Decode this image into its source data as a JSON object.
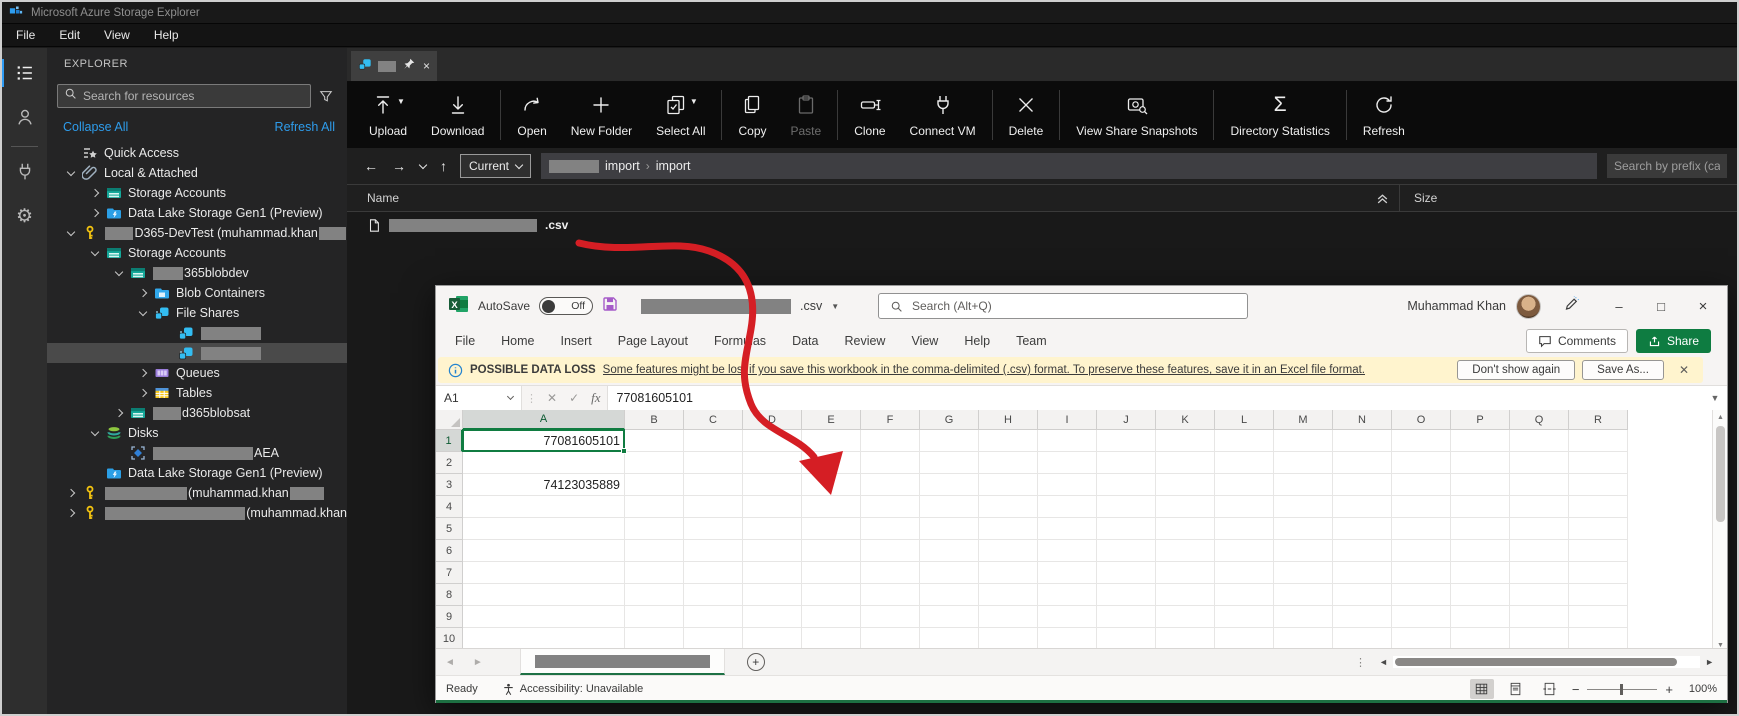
{
  "titleBar": {
    "title": "Microsoft Azure Storage Explorer"
  },
  "menuBar": {
    "items": [
      "File",
      "Edit",
      "View",
      "Help"
    ]
  },
  "activityBar": {
    "items": [
      {
        "icon": "explorer",
        "active": true
      },
      {
        "icon": "account",
        "active": false
      },
      {
        "icon": "plug",
        "active": false
      },
      {
        "icon": "settings",
        "active": false
      }
    ]
  },
  "explorer": {
    "header": "EXPLORER",
    "search": {
      "placeholder": "Search for resources"
    },
    "collapseAll": "Collapse All",
    "refreshAll": "Refresh All",
    "tree": [
      {
        "level": 0,
        "chevron": null,
        "icon": "quickaccess",
        "parts": [
          {
            "text": "Quick Access"
          }
        ]
      },
      {
        "level": 0,
        "chevron": "down",
        "icon": "attach",
        "parts": [
          {
            "text": "Local & Attached"
          }
        ]
      },
      {
        "level": 1,
        "chevron": "right",
        "icon": "storage",
        "parts": [
          {
            "text": "Storage Accounts"
          }
        ]
      },
      {
        "level": 1,
        "chevron": "right",
        "icon": "datalake",
        "parts": [
          {
            "text": "Data Lake Storage Gen1 (Preview)"
          }
        ]
      },
      {
        "level": 0,
        "chevron": "down",
        "icon": "key",
        "parts": [
          {
            "redact": 44
          },
          {
            "text": "D365-DevTest (muhammad.khan"
          },
          {
            "redact": 42
          }
        ]
      },
      {
        "level": 1,
        "chevron": "down",
        "icon": "storage",
        "parts": [
          {
            "text": "Storage Accounts"
          }
        ]
      },
      {
        "level": 2,
        "chevron": "down",
        "icon": "storage",
        "parts": [
          {
            "redact": 30
          },
          {
            "text": "365blobdev"
          }
        ]
      },
      {
        "level": 3,
        "chevron": "right",
        "icon": "blob",
        "parts": [
          {
            "text": "Blob Containers"
          }
        ]
      },
      {
        "level": 3,
        "chevron": "down",
        "icon": "fileshare",
        "parts": [
          {
            "text": "File Shares"
          }
        ]
      },
      {
        "level": 4,
        "chevron": null,
        "icon": "fileshare",
        "parts": [
          {
            "redact": 60
          }
        ]
      },
      {
        "level": 4,
        "chevron": null,
        "icon": "fileshare",
        "parts": [
          {
            "redact": 60
          }
        ],
        "selected": true
      },
      {
        "level": 3,
        "chevron": "right",
        "icon": "queue",
        "parts": [
          {
            "text": "Queues"
          }
        ]
      },
      {
        "level": 3,
        "chevron": "right",
        "icon": "table",
        "parts": [
          {
            "text": "Tables"
          }
        ]
      },
      {
        "level": 2,
        "chevron": "right",
        "icon": "storage",
        "parts": [
          {
            "redact": 28
          },
          {
            "text": "d365blobsat"
          }
        ]
      },
      {
        "level": 1,
        "chevron": "down",
        "icon": "disks",
        "parts": [
          {
            "text": "Disks"
          }
        ]
      },
      {
        "level": 2,
        "chevron": null,
        "icon": "disk",
        "parts": [
          {
            "redact": 100
          },
          {
            "text": "AEA"
          }
        ]
      },
      {
        "level": 1,
        "chevron": null,
        "icon": "datalake",
        "parts": [
          {
            "text": "Data Lake Storage Gen1 (Preview)"
          }
        ]
      },
      {
        "level": 0,
        "chevron": "right",
        "icon": "key",
        "parts": [
          {
            "redact": 82
          },
          {
            "text": "(muhammad.khan"
          },
          {
            "redact": 34
          }
        ]
      },
      {
        "level": 0,
        "chevron": "right",
        "icon": "key",
        "parts": [
          {
            "redact": 142
          },
          {
            "text": "(muhammad.khan"
          }
        ]
      }
    ]
  },
  "mainPane": {
    "tab": {
      "redact": 30
    },
    "toolbar": [
      {
        "label": "Upload",
        "icon": "upload",
        "caret": true
      },
      {
        "label": "Download",
        "icon": "download"
      },
      {
        "sep": true
      },
      {
        "label": "Open",
        "icon": "open"
      },
      {
        "label": "New Folder",
        "icon": "plus"
      },
      {
        "label": "Select All",
        "icon": "selectall",
        "caret": true
      },
      {
        "sep": true
      },
      {
        "label": "Copy",
        "icon": "copy"
      },
      {
        "label": "Paste",
        "icon": "paste",
        "disabled": true
      },
      {
        "sep": true
      },
      {
        "label": "Clone",
        "icon": "clone"
      },
      {
        "label": "Connect VM",
        "icon": "plug2"
      },
      {
        "sep": true
      },
      {
        "label": "Delete",
        "icon": "delete"
      },
      {
        "sep": true
      },
      {
        "label": "View Share Snapshots",
        "icon": "snapshot"
      },
      {
        "sep": true
      },
      {
        "label": "Directory Statistics",
        "icon": "sigma"
      },
      {
        "sep": true
      },
      {
        "label": "Refresh",
        "icon": "refresh"
      }
    ],
    "nav": {
      "scope": "Current",
      "path": {
        "redact": 50,
        "segments": [
          "import",
          "import"
        ]
      },
      "prefixSearchPlaceholder": "Search by prefix (ca"
    },
    "fileTable": {
      "nameHeader": "Name",
      "sizeHeader": "Size",
      "row": {
        "redact": 148,
        "extension": ".csv"
      }
    }
  },
  "excel": {
    "autoSave": {
      "label": "AutoSave",
      "state": "Off"
    },
    "doc": {
      "redact": 150,
      "extension": ".csv"
    },
    "search": {
      "placeholder": "Search (Alt+Q)"
    },
    "user": {
      "name": "Muhammad Khan"
    },
    "ribbonTabs": [
      "File",
      "Home",
      "Insert",
      "Page Layout",
      "Formulas",
      "Data",
      "Review",
      "View",
      "Help",
      "Team"
    ],
    "actions": {
      "comments": "Comments",
      "share": "Share"
    },
    "warning": {
      "title": "POSSIBLE DATA LOSS",
      "message": "Some features might be lost if you save this workbook in the comma-delimited (.csv) format. To preserve these features, save it in an Excel file format.",
      "dismiss": "Don't show again",
      "saveAs": "Save As..."
    },
    "formula": {
      "nameBox": "A1",
      "fx": "fx",
      "value": "77081605101"
    },
    "grid": {
      "columns": [
        "A",
        "B",
        "C",
        "D",
        "E",
        "F",
        "G",
        "H",
        "I",
        "J",
        "K",
        "L",
        "M",
        "N",
        "O",
        "P",
        "Q",
        "R"
      ],
      "rowCount": 10,
      "cells": {
        "A1": "77081605101",
        "A3": "74123035889"
      },
      "selectedCell": "A1"
    },
    "sheetBar": {
      "tabRedact": 175
    },
    "status": {
      "ready": "Ready",
      "accessibility": "Accessibility: Unavailable",
      "zoom": "100%"
    }
  },
  "colors": {
    "accentGreen": "#107c41",
    "linkBlue": "#2e9ceb",
    "annotationRed": "#d51e24",
    "redaction": "#828282"
  }
}
